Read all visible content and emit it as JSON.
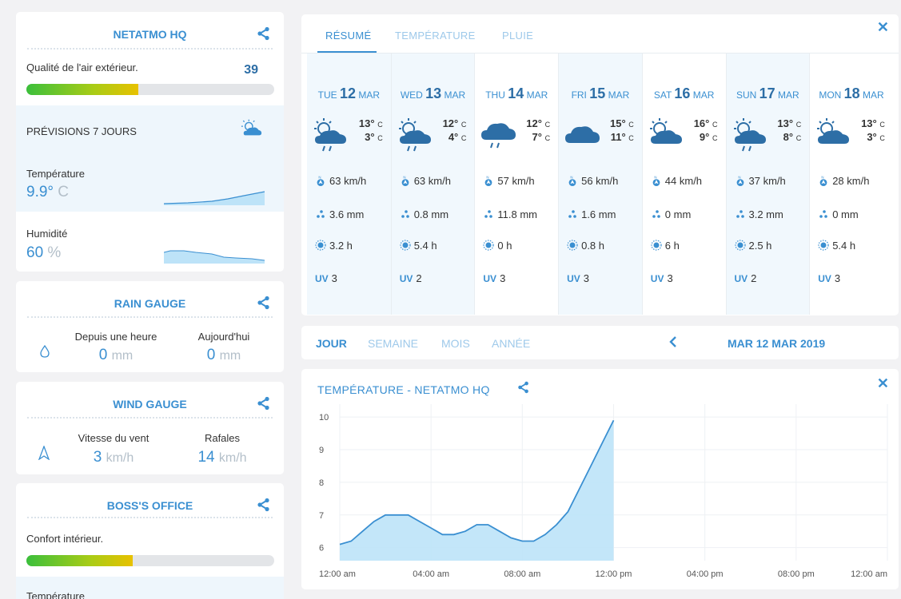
{
  "colors": {
    "accent": "#3a8fd1",
    "light_accent": "#9ec9ea",
    "fill": "#bde3f8"
  },
  "stations": {
    "hq": {
      "title": "NETATMO HQ",
      "air_quality_label": "Qualité de l'air extérieur.",
      "air_quality_value": "39",
      "air_quality_level": 0.45,
      "forecast_label": "PRÉVISIONS 7 JOURS",
      "temp_label": "Température",
      "temp_value": "9.9°",
      "temp_unit": "C",
      "humidity_label": "Humidité",
      "humidity_value": "60",
      "humidity_unit": "%"
    },
    "rain": {
      "title": "RAIN GAUGE",
      "col1_label": "Depuis une heure",
      "col1_value": "0",
      "col1_unit": "mm",
      "col2_label": "Aujourd'hui",
      "col2_value": "0",
      "col2_unit": "mm"
    },
    "wind": {
      "title": "WIND GAUGE",
      "col1_label": "Vitesse du vent",
      "col1_value": "3",
      "col1_unit": "km/h",
      "col2_label": "Rafales",
      "col2_value": "14",
      "col2_unit": "km/h"
    },
    "boss": {
      "title": "BOSS'S OFFICE",
      "comfort_label": "Confort intérieur.",
      "comfort_level": 0.43,
      "temp_label": "Température"
    }
  },
  "forecast": {
    "tabs": [
      "RÉSUMÉ",
      "TEMPÉRATURE",
      "PLUIE"
    ],
    "days": [
      {
        "dow": "TUE",
        "num": "12",
        "mon": "MAR",
        "hi": "13°",
        "lo": "3°",
        "unit": "C",
        "wind": "63 km/h",
        "rain": "3.6 mm",
        "sun": "3.2 h",
        "uv_label": "UV",
        "uv": "3",
        "icon": "sun-cloud-rain",
        "hl": true
      },
      {
        "dow": "WED",
        "num": "13",
        "mon": "MAR",
        "hi": "12°",
        "lo": "4°",
        "unit": "C",
        "wind": "63 km/h",
        "rain": "0.8 mm",
        "sun": "5.4 h",
        "uv_label": "UV",
        "uv": "2",
        "icon": "sun-cloud-rain",
        "hl": true
      },
      {
        "dow": "THU",
        "num": "14",
        "mon": "MAR",
        "hi": "12°",
        "lo": "7°",
        "unit": "C",
        "wind": "57 km/h",
        "rain": "11.8 mm",
        "sun": "0 h",
        "uv_label": "UV",
        "uv": "3",
        "icon": "cloud-rain",
        "hl": false
      },
      {
        "dow": "FRI",
        "num": "15",
        "mon": "MAR",
        "hi": "15°",
        "lo": "11°",
        "unit": "C",
        "wind": "56 km/h",
        "rain": "1.6 mm",
        "sun": "0.8 h",
        "uv_label": "UV",
        "uv": "3",
        "icon": "cloud",
        "hl": true
      },
      {
        "dow": "SAT",
        "num": "16",
        "mon": "MAR",
        "hi": "16°",
        "lo": "9°",
        "unit": "C",
        "wind": "44 km/h",
        "rain": "0 mm",
        "sun": "6 h",
        "uv_label": "UV",
        "uv": "3",
        "icon": "sun-cloud",
        "hl": false
      },
      {
        "dow": "SUN",
        "num": "17",
        "mon": "MAR",
        "hi": "13°",
        "lo": "8°",
        "unit": "C",
        "wind": "37 km/h",
        "rain": "3.2 mm",
        "sun": "2.5 h",
        "uv_label": "UV",
        "uv": "2",
        "icon": "sun-cloud-rain",
        "hl": true
      },
      {
        "dow": "MON",
        "num": "18",
        "mon": "MAR",
        "hi": "13°",
        "lo": "3°",
        "unit": "C",
        "wind": "28 km/h",
        "rain": "0 mm",
        "sun": "5.4 h",
        "uv_label": "UV",
        "uv": "3",
        "icon": "sun-cloud",
        "hl": false
      }
    ]
  },
  "period": {
    "tabs": [
      "JOUR",
      "SEMAINE",
      "MOIS",
      "ANNÉE"
    ],
    "date": "MAR 12 MAR 2019"
  },
  "chart_data": {
    "type": "area",
    "title": "TEMPÉRATURE -  NETATMO HQ",
    "x_ticks": [
      "12:00 am",
      "04:00 am",
      "08:00 am",
      "12:00 pm",
      "04:00 pm",
      "08:00 pm",
      "12:00 am"
    ],
    "y_ticks": [
      "6",
      "7",
      "8",
      "9",
      "10"
    ],
    "ylim": [
      5.6,
      10.2
    ],
    "xlim": [
      0,
      24
    ],
    "grid": true,
    "x": [
      0,
      0.5,
      1,
      1.5,
      2,
      2.5,
      3,
      3.5,
      4,
      4.5,
      5,
      5.5,
      6,
      6.5,
      7,
      7.5,
      8,
      8.5,
      9,
      9.5,
      10,
      10.5,
      11,
      11.5,
      12
    ],
    "y": [
      6.1,
      6.2,
      6.5,
      6.8,
      7.0,
      7.0,
      7.0,
      6.8,
      6.6,
      6.4,
      6.4,
      6.5,
      6.7,
      6.7,
      6.5,
      6.3,
      6.2,
      6.2,
      6.4,
      6.7,
      7.1,
      7.8,
      8.5,
      9.2,
      9.9
    ]
  }
}
